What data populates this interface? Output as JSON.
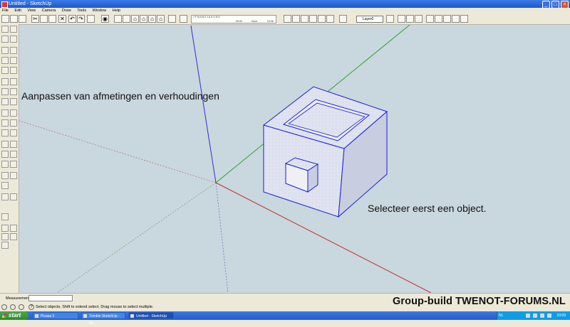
{
  "window": {
    "title": "Untitled - SketchUp",
    "min": "_",
    "max": "□",
    "close": "×"
  },
  "menu": [
    "File",
    "Edit",
    "View",
    "Camera",
    "Draw",
    "Tools",
    "Window",
    "Help"
  ],
  "toolbar": {
    "months": "J F M A M J J A S O N D",
    "time_left": "06:43",
    "time_mid": "Noon",
    "time_right": "04:46",
    "layer_value": "Layer0"
  },
  "viewport": {
    "caption_title": "Aanpassen van afmetingen en verhoudingen",
    "caption_hint": "Selecteer eerst een object."
  },
  "statusbar": {
    "measurements_label": "Measurements",
    "hint": "Select objects. Shift to extend select. Drag mouse to select multiple."
  },
  "watermark": "Group-build TWENOT-FORUMS.NL",
  "taskbar": {
    "start": "start",
    "tasks": [
      "Picasa 3",
      "Trimble SketchUp - Wi...",
      "Untitled - SketchUp"
    ],
    "lang": "NL",
    "clock": "10:09"
  },
  "colors": {
    "viewport_bg": "#c9d7df",
    "selection_blue": "#1a1fd0",
    "axis_red": "#c03030",
    "axis_green": "#30a030",
    "axis_blue": "#3030d0"
  }
}
